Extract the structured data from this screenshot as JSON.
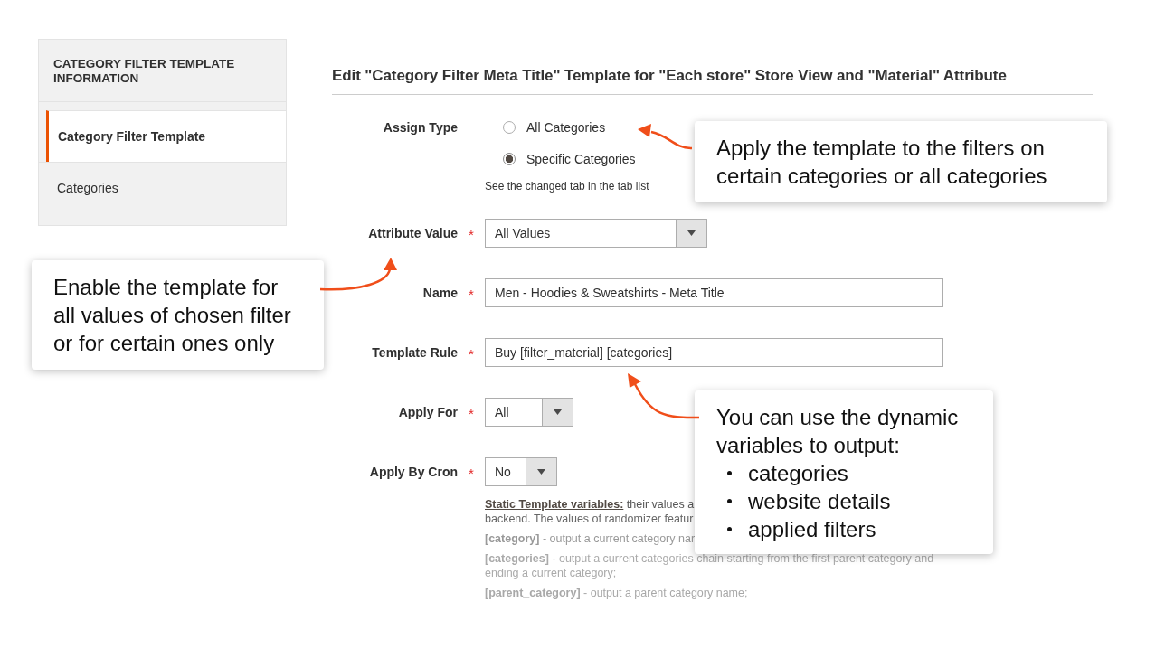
{
  "sidebar": {
    "title": "CATEGORY FILTER TEMPLATE INFORMATION",
    "items": [
      {
        "label": "Category Filter Template",
        "selected": true
      },
      {
        "label": "Categories",
        "selected": false
      }
    ]
  },
  "form": {
    "heading": "Edit \"Category Filter Meta Title\" Template for \"Each store\" Store View and \"Material\" Attribute",
    "fields": [
      {
        "kind": "radio",
        "label": "Assign Type",
        "options": [
          {
            "label": "All Categories",
            "selected": false
          },
          {
            "label": "Specific Categories",
            "selected": true
          }
        ],
        "note": "See the changed tab in the tab list"
      },
      {
        "kind": "select",
        "label": "Attribute Value",
        "required": "*",
        "value": "All Values"
      },
      {
        "kind": "text",
        "label": "Name",
        "required": "*",
        "value": "Men - Hoodies & Sweatshirts - Meta Title"
      },
      {
        "kind": "text",
        "label": "Template Rule",
        "required": "*",
        "value": "Buy [filter_material] [categories]"
      },
      {
        "kind": "select",
        "label": "Apply For",
        "required": "*",
        "value": "All"
      },
      {
        "kind": "select",
        "label": "Apply By Cron",
        "required": "*",
        "value": "No"
      }
    ],
    "help": {
      "term": "Static Template variables:",
      "term_text": "their values a",
      "lines": [
        "backend. The values of randomizer featur",
        "**[category]** - output a current category nar",
        "**[categories]** - output a current categories chain starting from the first parent category and ending a current category;",
        "**[parent_category]** - output a parent category name;"
      ]
    }
  },
  "callouts": [
    {
      "text": "Apply the template to the filters on certain categories or all categories"
    },
    {
      "text": "Enable the template for all values of chosen filter or for certain ones only"
    },
    {
      "text": "You can use the dynamic variables to output:",
      "items": [
        "categories",
        "website details",
        "applied filters"
      ]
    }
  ]
}
